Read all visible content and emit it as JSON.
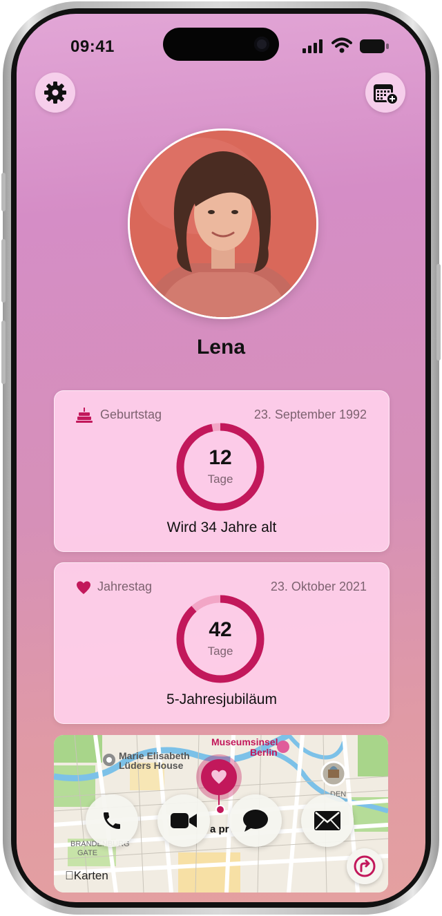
{
  "status": {
    "time": "09:41"
  },
  "profile": {
    "name": "Lena"
  },
  "birthday": {
    "label": "Geburtstag",
    "date": "23. September 1992",
    "days": "12",
    "unit": "Tage",
    "subtitle": "Wird 34 Jahre alt",
    "progress": 0.967,
    "icon": "birthday-cake-icon"
  },
  "anniversary": {
    "label": "Jahrestag",
    "date": "23. Oktober 2021",
    "days": "42",
    "unit": "Tage",
    "subtitle": "5-Jahresjubiläum",
    "progress": 0.885,
    "icon": "heart-icon"
  },
  "map": {
    "labels": [
      "Museumsinsel",
      "Berlin",
      "Marie Elisabeth",
      "Lüders House",
      "BRANDENBURG",
      "GATE",
      "DEN"
    ],
    "partial_label": "a pr",
    "attribution": "Karten"
  },
  "actions": [
    "phone-icon",
    "video-icon",
    "message-icon",
    "mail-icon"
  ],
  "colors": {
    "accent": "#c2185b",
    "ring_track": "#f2a6c6",
    "card": "#ffd0ec"
  }
}
